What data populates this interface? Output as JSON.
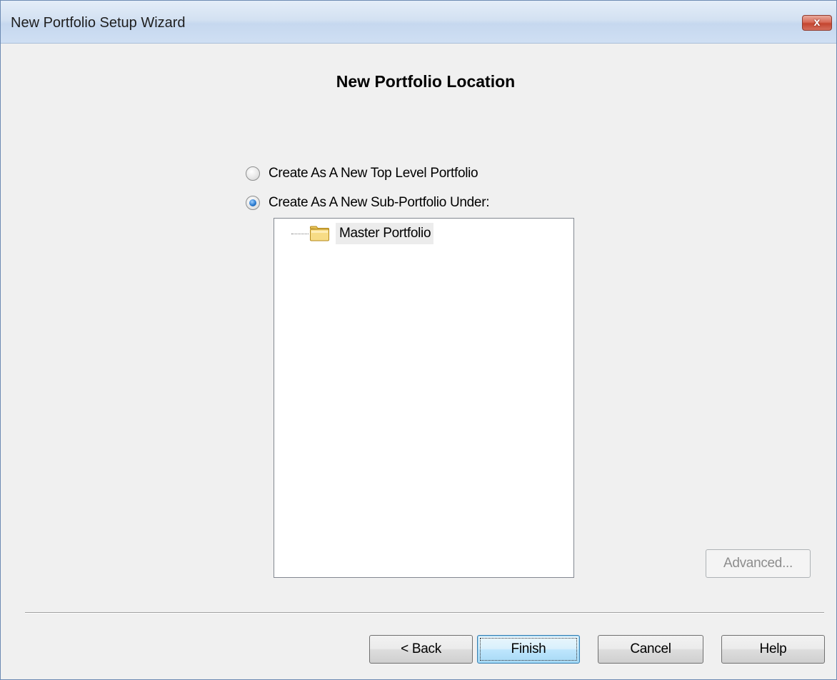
{
  "window": {
    "title": "New Portfolio Setup Wizard",
    "close_label": "x"
  },
  "main": {
    "heading": "New Portfolio Location",
    "options": [
      {
        "label": "Create As A New Top Level Portfolio",
        "selected": false
      },
      {
        "label": "Create As A New Sub-Portfolio Under:",
        "selected": true
      }
    ],
    "tree": {
      "items": [
        {
          "label": "Master Portfolio",
          "icon": "folder-icon",
          "selected": true
        }
      ]
    },
    "advanced_label": "Advanced..."
  },
  "footer": {
    "back_label": "< Back",
    "finish_label": "Finish",
    "cancel_label": "Cancel",
    "help_label": "Help"
  },
  "colors": {
    "titlebar": "#d3e1f2",
    "close_button": "#c4452f",
    "default_button": "#bee6fd",
    "background": "#f0f0f0"
  }
}
